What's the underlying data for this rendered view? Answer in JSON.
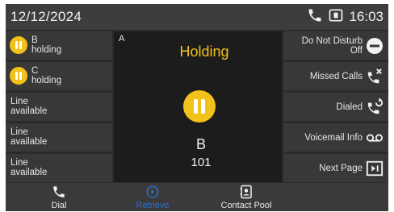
{
  "status_bar": {
    "date": "12/12/2024",
    "time": "16:03",
    "icons": [
      "handset-icon",
      "line-key-icon"
    ]
  },
  "line_keys": [
    {
      "name": "B",
      "state": "holding",
      "icon": "hold-icon"
    },
    {
      "name": "C",
      "state": "holding",
      "icon": "hold-icon"
    },
    {
      "name": "Line",
      "state": "available"
    },
    {
      "name": "Line",
      "state": "available"
    },
    {
      "name": "Line",
      "state": "available"
    }
  ],
  "call": {
    "line": "A",
    "status": "Holding",
    "name": "B",
    "number": "101"
  },
  "right_keys": {
    "dnd_line1": "Do Not Disturb",
    "dnd_line2": "Off",
    "missed": "Missed Calls",
    "dialed": "Dialed",
    "voicemail": "Voicemail Info",
    "next_page": "Next Page"
  },
  "softkeys": {
    "dial": "Dial",
    "retrieve": "Retrieve",
    "contact_pool": "Contact Pool"
  },
  "colors": {
    "hold_accent": "#f2c21b",
    "active_softkey": "#2d6fd1",
    "key_background": "#383838",
    "center_background": "#1c1c1c"
  }
}
